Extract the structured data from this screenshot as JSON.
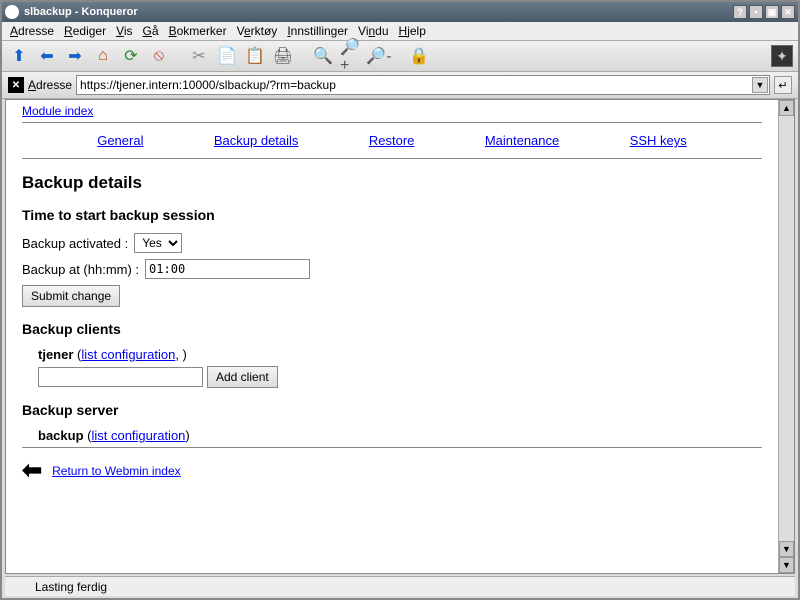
{
  "window": {
    "title": "slbackup - Konqueror"
  },
  "menubar": {
    "adresse": "Adresse",
    "rediger": "Rediger",
    "vis": "Vis",
    "ga": "Gå",
    "bokmerker": "Bokmerker",
    "verktoy": "Verktøy",
    "innstillinger": "Innstillinger",
    "vindu": "Vindu",
    "hjelp": "Hjelp"
  },
  "addressbar": {
    "label": "Adresse",
    "url": "https://tjener.intern:10000/slbackup/?rm=backup"
  },
  "page": {
    "module_index": "Module index",
    "tabs": {
      "general": "General",
      "backup_details": "Backup details",
      "restore": "Restore",
      "maintenance": "Maintenance",
      "ssh_keys": "SSH keys"
    },
    "heading": "Backup details",
    "session_heading": "Time to start backup session",
    "activated_label": "Backup activated  :",
    "activated_value": "Yes",
    "backup_at_label": "Backup at (hh:mm) :",
    "backup_at_value": "01:00",
    "submit_label": "Submit change",
    "clients_heading": "Backup clients",
    "client_name": "tjener",
    "list_config": "list configuration",
    "add_client_label": "Add client",
    "server_heading": "Backup server",
    "server_name": "backup",
    "return_label": "Return to Webmin index"
  },
  "status": {
    "text": "Lasting ferdig"
  }
}
